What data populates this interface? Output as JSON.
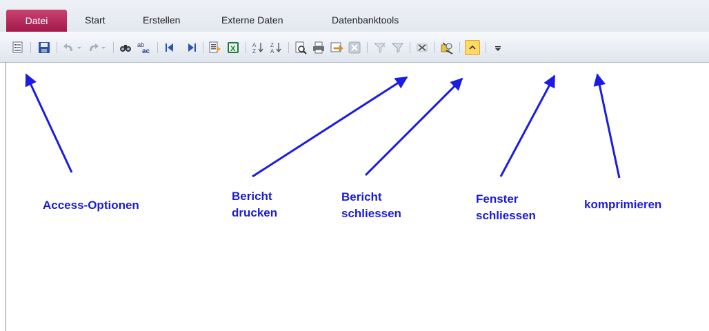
{
  "tabs": {
    "file": "Datei",
    "start": "Start",
    "create": "Erstellen",
    "external": "Externe Daten",
    "dbtools": "Datenbanktools"
  },
  "annotations": {
    "access_options": "Access-Optionen",
    "print_report_1": "Bericht",
    "print_report_2": "drucken",
    "close_report_1": "Bericht",
    "close_report_2": "schliessen",
    "close_window_1": "Fenster",
    "close_window_2": "schliessen",
    "compact": "komprimieren"
  },
  "colors": {
    "file_tab": "#b42556",
    "annotation": "#1a1adb",
    "arrow": "#1b1be6"
  }
}
